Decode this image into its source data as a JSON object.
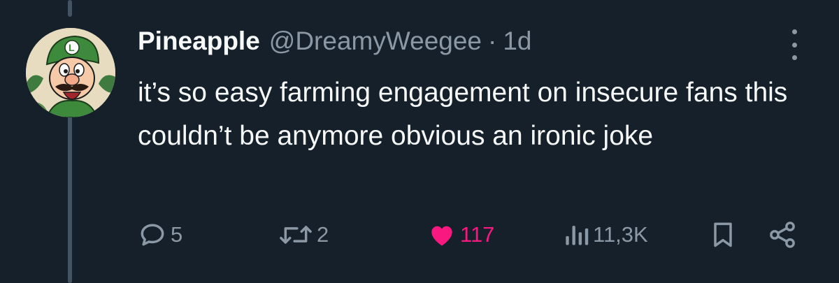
{
  "tweet": {
    "display_name": "Pineapple",
    "handle": "@DreamyWeegee",
    "separator": "·",
    "time": "1d",
    "text": "it’s so easy farming engagement on insecure fans this couldn’t be anymore obvious an ironic joke"
  },
  "actions": {
    "reply_count": "5",
    "retweet_count": "2",
    "like_count": "117",
    "view_count": "11,3K"
  },
  "colors": {
    "background": "#15202b",
    "primary_text": "#f7f9f9",
    "secondary_text": "#8b98a5",
    "like_active": "#f91880",
    "thread_line": "#425364"
  },
  "icons": {
    "more": "more-dots-icon",
    "reply": "reply-bubble-icon",
    "retweet": "retweet-icon",
    "like": "heart-filled-icon",
    "views": "views-bars-icon",
    "bookmark": "bookmark-icon",
    "share": "share-icon"
  }
}
